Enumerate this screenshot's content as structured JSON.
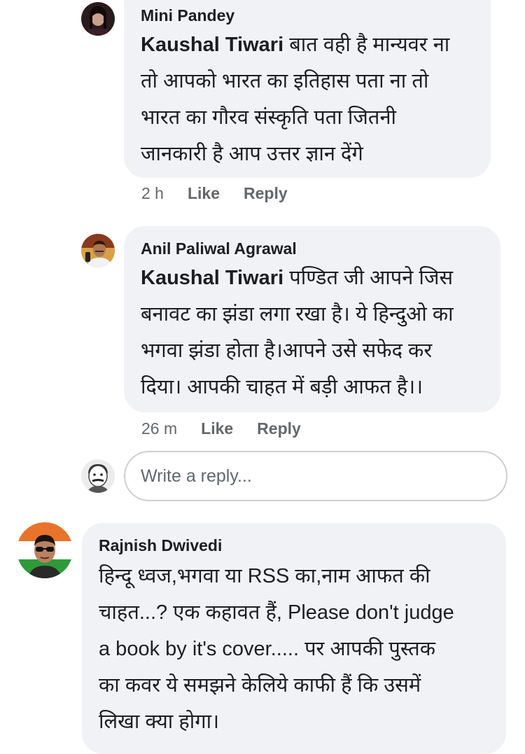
{
  "comments": [
    {
      "author": "Mini Pandey",
      "mention": "Kaushal Tiwari",
      "lines": [
        "बात वही है मान्यवर ना",
        "तो आपको भारत का इतिहास पता ना तो",
        "भारत का गौरव संस्कृति पता जितनी",
        "जानकारी है आप उत्तर ज्ञान देंगे"
      ],
      "time": "2 h",
      "like": "Like",
      "reply": "Reply"
    },
    {
      "author": "Anil Paliwal Agrawal",
      "mention": "Kaushal Tiwari",
      "lines": [
        "पण्डित जी आपने जिस",
        "बनावट का झंडा लगा रखा है। ये हिन्दुओ का",
        "भगवा झंडा होता है।आपने उसे सफेद कर",
        "दिया। आपकी चाहत में बड़ी आफत है।।"
      ],
      "time": "26 m",
      "like": "Like",
      "reply": "Reply"
    },
    {
      "author": "Rajnish Dwivedi",
      "lines": [
        "हिन्दू ध्वज,भगवा या RSS का,नाम आफत की",
        "चाहत...? एक कहावत हैं, Please don't judge",
        "a book by it's cover..... पर आपकी पुस्तक",
        "का कवर ये समझने केलिये काफी हैं कि उसमें",
        "लिखा क्या होगा।"
      ]
    }
  ],
  "reply_input": {
    "placeholder": "Write a reply..."
  },
  "colors": {
    "bubble": "#f0f2f5",
    "meta_text": "#65676b",
    "input_border": "#ccd0d5"
  }
}
